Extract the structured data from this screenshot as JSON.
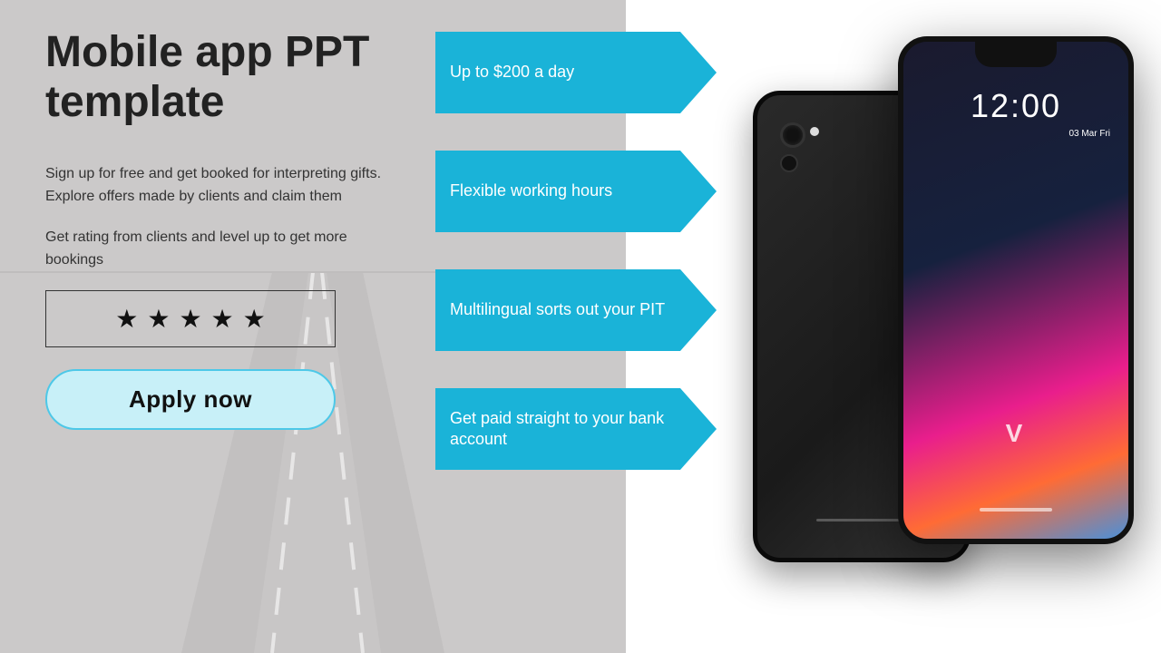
{
  "page": {
    "title": "Mobile app PPT template",
    "description1": "Sign up for free and get booked for interpreting gifts. Explore offers made by clients and claim them",
    "description2": "Get rating from clients and level up to get more bookings",
    "stars": [
      "★",
      "★",
      "★",
      "★",
      "★"
    ],
    "apply_button": "Apply now",
    "arrows": [
      {
        "id": 1,
        "text": "Up to $200 a day"
      },
      {
        "id": 2,
        "text": "Flexible working hours"
      },
      {
        "id": 3,
        "text": "Multilingual sorts out your PIT"
      },
      {
        "id": 4,
        "text": "Get paid straight to your bank account"
      }
    ],
    "phone": {
      "time": "12:00",
      "date": "03 Mar\nFri",
      "brand": "V"
    },
    "colors": {
      "arrow_bg": "#1ab3d8",
      "apply_border": "#4dc8e8",
      "apply_bg": "#c8f0f8"
    }
  }
}
